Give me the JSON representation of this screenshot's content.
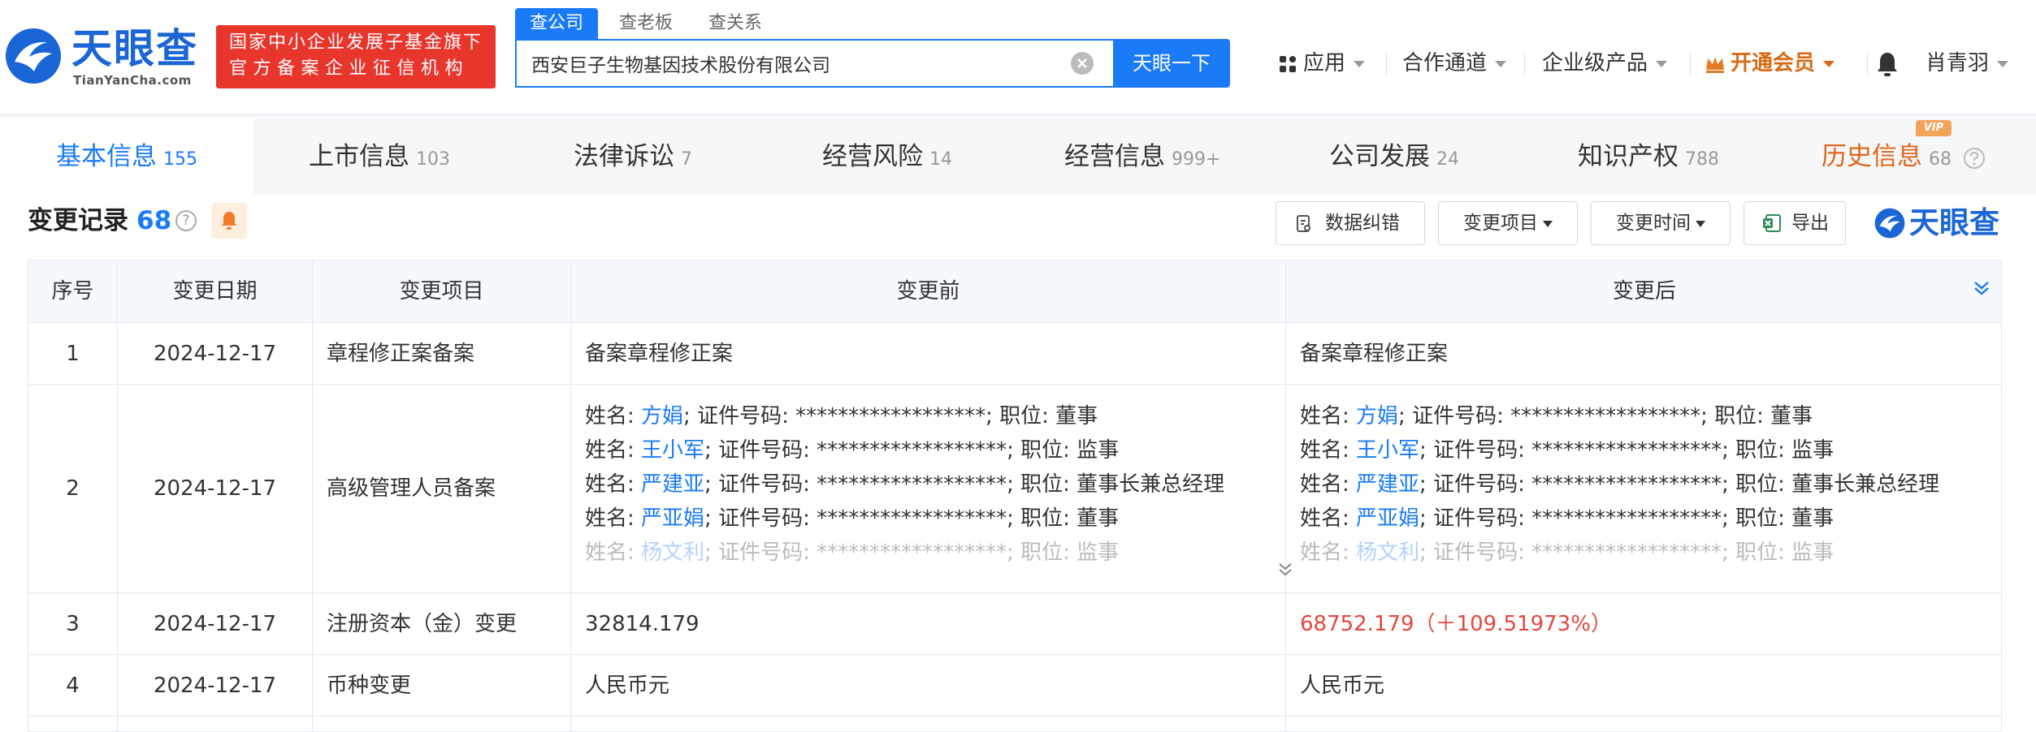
{
  "header": {
    "logo_text": "天眼查",
    "logo_domain": "TianYanCha.com",
    "badge_line1": "国家中小企业发展子基金旗下",
    "badge_line2": "官方备案企业征信机构",
    "search_tabs": [
      "查公司",
      "查老板",
      "查关系"
    ],
    "search_value": "西安巨子生物基因技术股份有限公司",
    "search_button": "天眼一下",
    "nav": {
      "apps": "应用",
      "channel": "合作通道",
      "enterprise": "企业级产品",
      "vip": "开通会员",
      "user": "肖青羽"
    }
  },
  "tabs": [
    {
      "label": "基本信息",
      "count": "155"
    },
    {
      "label": "上市信息",
      "count": "103"
    },
    {
      "label": "法律诉讼",
      "count": "7"
    },
    {
      "label": "经营风险",
      "count": "14"
    },
    {
      "label": "经营信息",
      "count": "999+"
    },
    {
      "label": "公司发展",
      "count": "24"
    },
    {
      "label": "知识产权",
      "count": "788"
    },
    {
      "label": "历史信息",
      "count": "68"
    }
  ],
  "vip_tag": "VIP",
  "section": {
    "title": "变更记录",
    "count": "68",
    "help": "?",
    "toolbar": {
      "correct": "数据纠错",
      "item": "变更项目",
      "time": "变更时间",
      "export": "导出"
    },
    "brand": "天眼查"
  },
  "table": {
    "headers": [
      "序号",
      "变更日期",
      "变更项目",
      "变更前",
      "变更后"
    ],
    "rows": [
      {
        "no": "1",
        "date": "2024-12-17",
        "item": "章程修正案备案",
        "before": "备案章程修正案",
        "after": "备案章程修正案"
      },
      {
        "no": "2",
        "date": "2024-12-17",
        "item": "高级管理人员备案",
        "before_lines": [
          {
            "name_label": "姓名: ",
            "name": "方娟",
            "rest": "; 证件号码: ******************; 职位: 董事"
          },
          {
            "name_label": "姓名: ",
            "name": "王小军",
            "rest": "; 证件号码: ******************; 职位: 监事"
          },
          {
            "name_label": "姓名: ",
            "name": "严建亚",
            "rest": "; 证件号码: ******************; 职位: 董事长兼总经理"
          },
          {
            "name_label": "姓名: ",
            "name": "严亚娟",
            "rest": "; 证件号码: ******************; 职位: 董事"
          },
          {
            "name_label": "姓名: ",
            "name": "杨文利",
            "rest": "; 证件号码: ******************; 职位: 监事"
          }
        ],
        "after_lines": [
          {
            "name_label": "姓名: ",
            "name": "方娟",
            "rest": "; 证件号码: ******************; 职位: 董事"
          },
          {
            "name_label": "姓名: ",
            "name": "王小军",
            "rest": "; 证件号码: ******************; 职位: 监事"
          },
          {
            "name_label": "姓名: ",
            "name": "严建亚",
            "rest": "; 证件号码: ******************; 职位: 董事长兼总经理"
          },
          {
            "name_label": "姓名: ",
            "name": "严亚娟",
            "rest": "; 证件号码: ******************; 职位: 董事"
          },
          {
            "name_label": "姓名: ",
            "name": "杨文利",
            "rest": "; 证件号码: ******************; 职位: 监事"
          }
        ]
      },
      {
        "no": "3",
        "date": "2024-12-17",
        "item": "注册资本（金）变更",
        "before": "32814.179",
        "after": "68752.179（＋109.51973%）"
      },
      {
        "no": "4",
        "date": "2024-12-17",
        "item": "币种变更",
        "before": "人民币元",
        "after": "人民币元"
      }
    ]
  },
  "colors": {
    "brand_blue": "#1a7af8",
    "badge_red": "#e8362d",
    "history_orange": "#e0651a",
    "increase_red": "#e4473e"
  },
  "icons": [
    "logo-mark-icon",
    "clear-icon",
    "apps-grid-icon",
    "crown-icon",
    "bell-icon",
    "help-icon",
    "alert-bell-icon",
    "edit-doc-icon",
    "excel-icon",
    "expand-all-icon",
    "expand-row-icon"
  ]
}
